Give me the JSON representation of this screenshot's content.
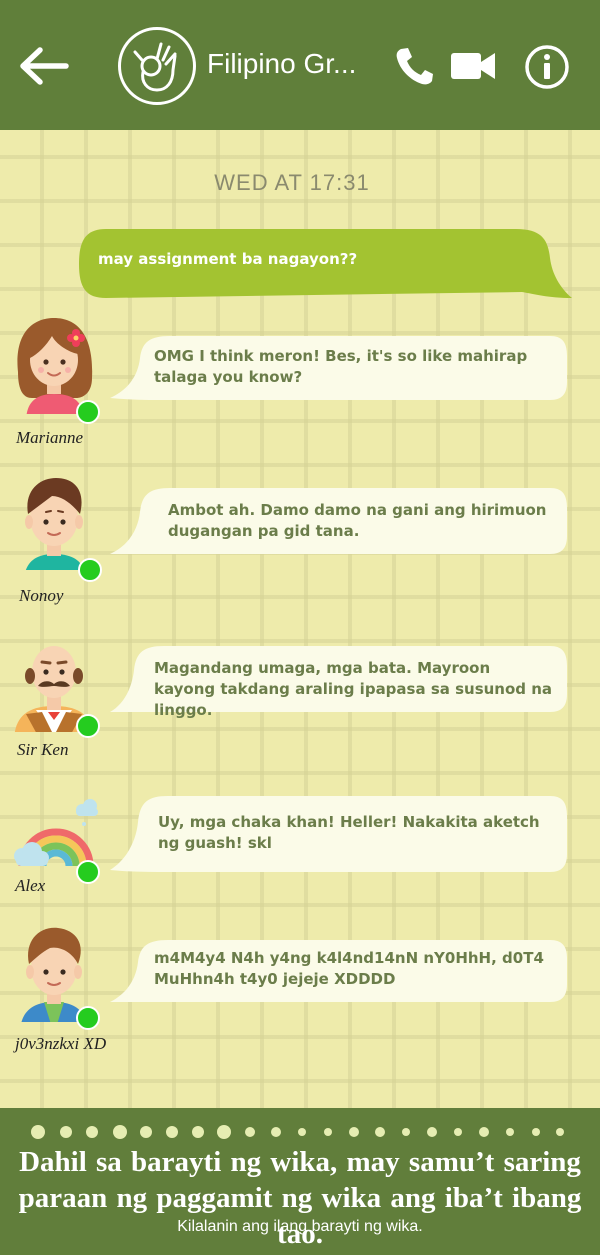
{
  "header": {
    "title": "Filipino Gr...",
    "back_icon": "arrow-left-icon",
    "avatar_icon": "ok-hand-icon",
    "call_icon": "phone-icon",
    "video_icon": "video-camera-icon",
    "info_icon": "info-icon",
    "background_color": "#607f3a"
  },
  "chat": {
    "timestamp": "WED AT 17:31",
    "sent_message": {
      "text": "may assignment ba nagayon??",
      "bubble_color": "#a3c331"
    },
    "messages": [
      {
        "sender": "Marianne",
        "text": "OMG I think meron! Bes, it's so like mahirap talaga you know?",
        "online": true,
        "avatar_icon": "girl-with-flower-avatar"
      },
      {
        "sender": "Nonoy",
        "text": "Ambot ah. Damo damo na gani ang hirimuon dugangan pa gid tana.",
        "online": true,
        "avatar_icon": "boy-avatar"
      },
      {
        "sender": "Sir Ken",
        "text": "Magandang umaga, mga bata. Mayroon kayong takdang araling ipapasa sa susunod na linggo.",
        "online": true,
        "avatar_icon": "teacher-mustache-avatar"
      },
      {
        "sender": "Alex",
        "text": "Uy, mga chaka khan! Heller! Nakakita aketch ng guash! skl",
        "online": true,
        "avatar_icon": "rainbow-avatar"
      },
      {
        "sender": "j0v3nzkxi XD",
        "text": "m4M4y4 N4h y4ng k4l4nd14nN nY0HhH, d0T4 MuHhn4h t4y0 jejeje XDDDD",
        "online": true,
        "avatar_icon": "boy-jacket-avatar"
      }
    ],
    "incoming_text_color": "#6b7d4a",
    "online_color": "#25cc1f"
  },
  "footer": {
    "title_line1": "Dahil sa barayti ng wika, may samu’t saring",
    "title_line2": "paraan ng paggamit ng wika ang iba’t ibang tao.",
    "subtitle": "Kilalanin ang ilang barayti ng wika.",
    "background_color": "#617e3b"
  }
}
